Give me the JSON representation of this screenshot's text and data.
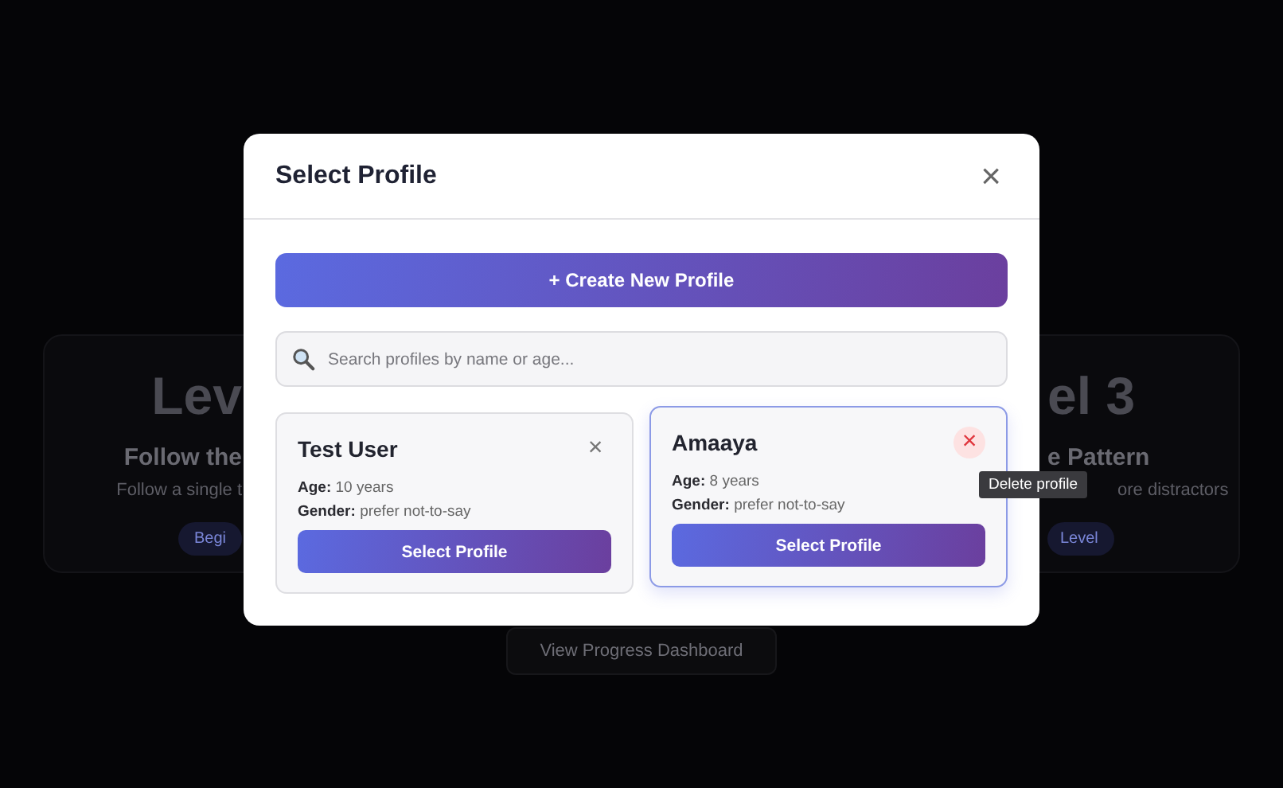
{
  "background": {
    "left_card": {
      "title": "Lev",
      "subtitle": "Follow the",
      "description": "Follow a single t",
      "button": "Begi"
    },
    "right_card": {
      "title": "el 3",
      "subtitle": "e Pattern",
      "description": "ore distractors",
      "button": "Level"
    },
    "dashboard_button": "View Progress Dashboard"
  },
  "modal": {
    "title": "Select Profile",
    "close": "×",
    "create_button": "+ Create New Profile",
    "search": {
      "placeholder": "Search profiles by name or age..."
    },
    "profiles": [
      {
        "name": "Test User",
        "age_label": "Age:",
        "age": "10 years",
        "gender_label": "Gender:",
        "gender": "prefer not-to-say",
        "delete": "×",
        "button": "Select Profile",
        "hovered": false
      },
      {
        "name": "Amaaya",
        "age_label": "Age:",
        "age": "8 years",
        "gender_label": "Gender:",
        "gender": "prefer not-to-say",
        "delete": "×",
        "button": "Select Profile",
        "hovered": true
      }
    ],
    "tooltip": "Delete profile"
  }
}
